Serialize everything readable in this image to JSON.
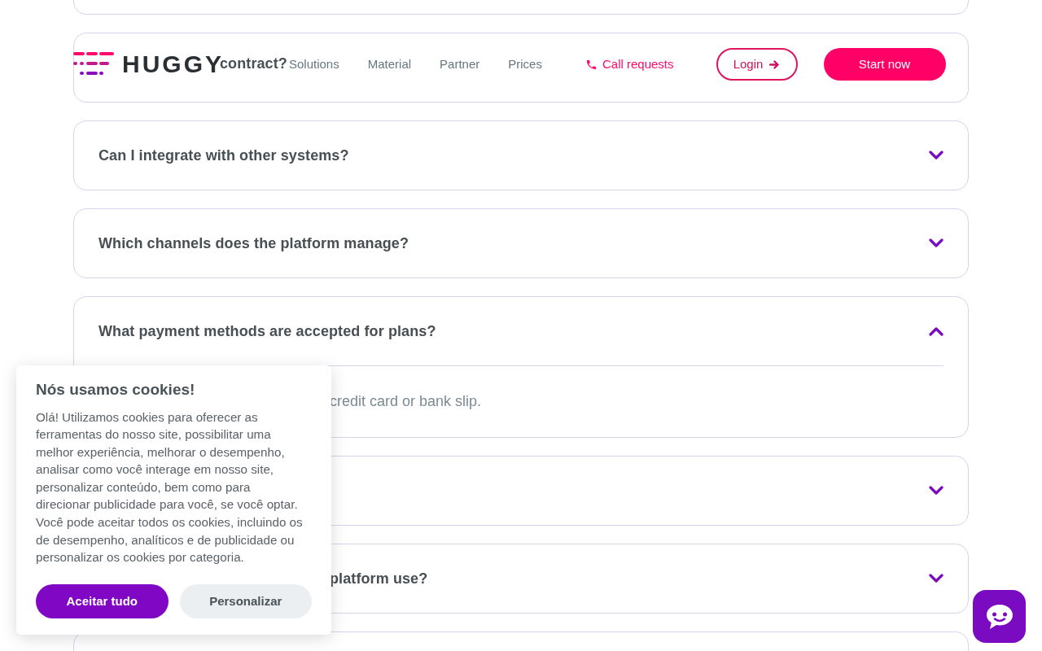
{
  "header": {
    "logo": "HUGGY",
    "nav": [
      "Solutions",
      "Material",
      "Partner",
      "Prices"
    ],
    "call_link": "Call requests",
    "login": "Login",
    "start": "Start now"
  },
  "faq": [
    {
      "expanded": false
    },
    {
      "question": "contract?",
      "expanded": false,
      "covered_by_header": true
    },
    {
      "question": "Can I integrate with other systems?",
      "expanded": false
    },
    {
      "question": "Which channels does the platform manage?",
      "expanded": false
    },
    {
      "question": "What payment methods are accepted for plans?",
      "expanded": true,
      "answer": {
        "text": "credit card or bank slip.",
        "covered_by_popup": true
      }
    },
    {
      "expanded": false
    },
    {
      "question": "platform use?",
      "expanded": false,
      "covered_by_popup": true
    },
    {
      "expanded": false
    }
  ],
  "cookie_popup": {
    "title": "Nós usamos cookies!",
    "body": "Olá! Utilizamos cookies para oferecer as ferramentas do nosso site, possibilitar uma melhor experiência, melhorar o desempenho, analisar como você interage em nosso site, personalizar conteúdo, bem como para direcionar publicidade para você, se você optar.\nVocê pode aceitar todos os cookies, incluindo os de desempenho, analíticos e de publicidade ou personalizar os cookies por categoria.",
    "accept": "Aceitar tudo",
    "customize": "Personalizar"
  }
}
